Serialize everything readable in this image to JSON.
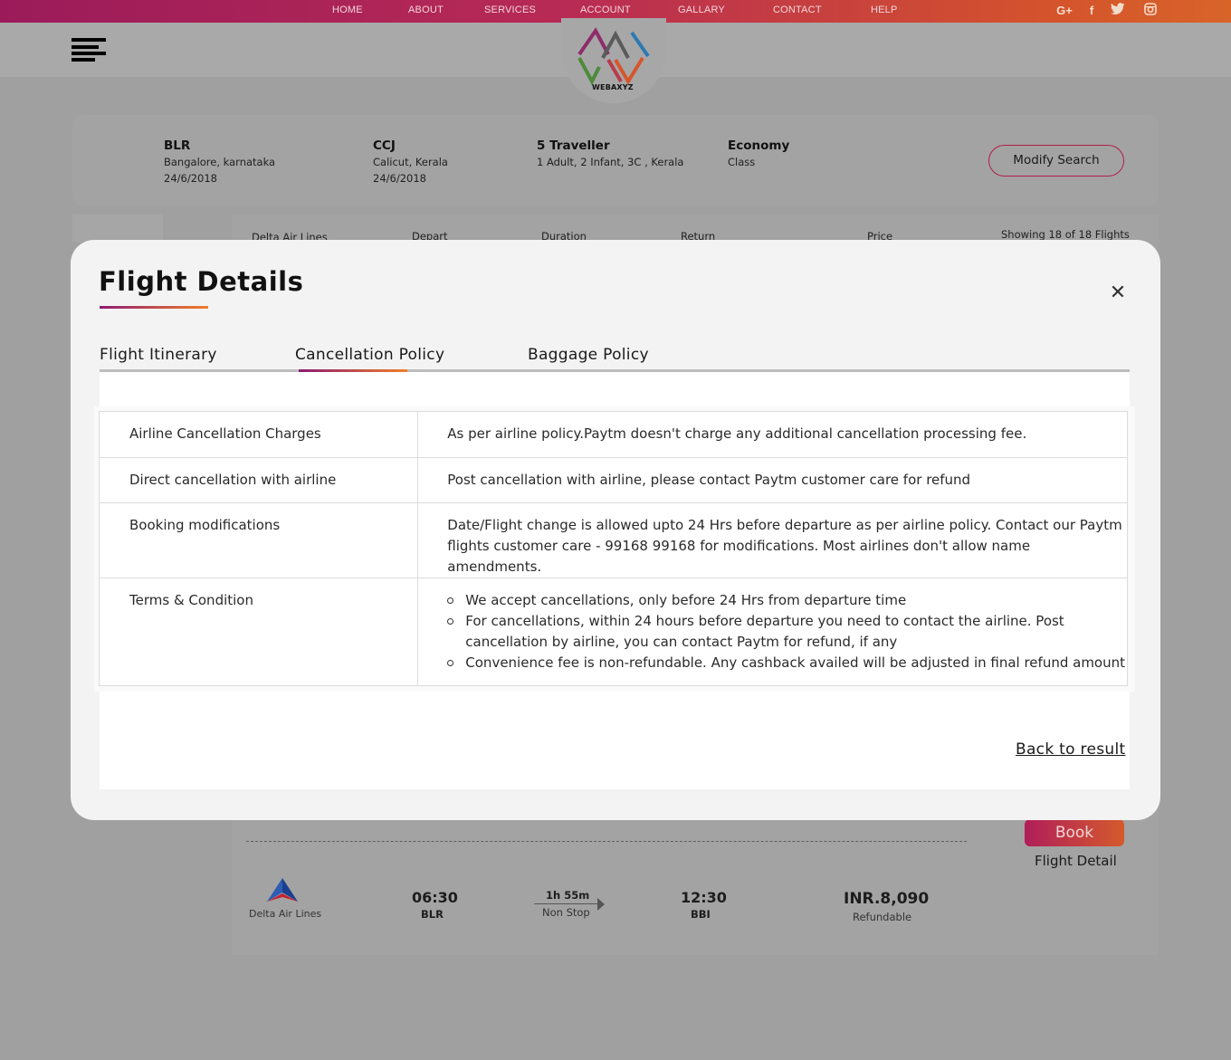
{
  "nav": {
    "links": [
      "HOME",
      "ABOUT",
      "SERVICES",
      "ACCOUNT",
      "GALLARY",
      "CONTACT",
      "HELP"
    ],
    "social_icons": [
      "google-plus-icon",
      "facebook-icon",
      "twitter-icon",
      "instagram-icon"
    ],
    "social_glyphs": [
      "G+",
      "f",
      "t",
      "ig"
    ]
  },
  "brand": {
    "name": "WEBAXYZ"
  },
  "search": {
    "from": {
      "code": "BLR",
      "city": "Bangalore, karnataka",
      "date": "24/6/2018"
    },
    "to": {
      "code": "CCJ",
      "city": "Calicut, Kerala",
      "date": "24/6/2018"
    },
    "travellers": {
      "title": "5 Traveller",
      "detail": "1 Adult, 2 Infant, 3C , Kerala"
    },
    "cabin": {
      "title": "Economy",
      "detail": "Class"
    },
    "modify_label": "Modify Search"
  },
  "results": {
    "columns": [
      "Delta Air Lines",
      "Depart",
      "Duration",
      "Return",
      "Price"
    ],
    "showing": "Showing 18 of 18 Flights",
    "book_label": "Book",
    "flight_detail_label": "Flight Detail",
    "row": {
      "airline": "Delta Air Lines",
      "depart_time": "06:30",
      "depart_code": "BLR",
      "duration": "1h 55m",
      "stops": "Non Stop",
      "arrive_time": "12:30",
      "arrive_code": "BBI",
      "price": "INR.8,090",
      "refund": "Refundable"
    }
  },
  "modal": {
    "title": "Flight Details",
    "close_glyph": "✕",
    "tabs": [
      {
        "label": "Flight Itinerary",
        "active": false
      },
      {
        "label": "Cancellation Policy",
        "active": true
      },
      {
        "label": "Baggage Policy",
        "active": false
      }
    ],
    "policy": [
      {
        "label": "Airline Cancellation Charges",
        "value": "As per airline policy.Paytm doesn't charge any additional cancellation processing fee."
      },
      {
        "label": "Direct cancellation with airline",
        "value": "Post cancellation with airline, please contact Paytm customer care for refund"
      },
      {
        "label": "Booking modifications",
        "value": "Date/Flight change is allowed upto 24 Hrs before departure as per airline policy. Contact our Paytm flights customer care - 99168 99168 for modifications. Most airlines don't allow name amendments."
      },
      {
        "label": "Terms & Condition",
        "bullets": [
          "We accept cancellations, only before 24 Hrs from departure time",
          "For cancellations, within 24 hours before departure you need to contact the airline. Post cancellation by airline, you can contact Paytm for refund, if any",
          "Convenience fee is non-refundable. Any cashback availed will be adjusted in final refund amount"
        ]
      }
    ],
    "back_label": "Back to result"
  },
  "colors": {
    "brand_start": "#9b1b5a",
    "brand_end": "#d8642a",
    "overlay": "#a0a0a0",
    "modal_bg": "#f3f3f3"
  }
}
